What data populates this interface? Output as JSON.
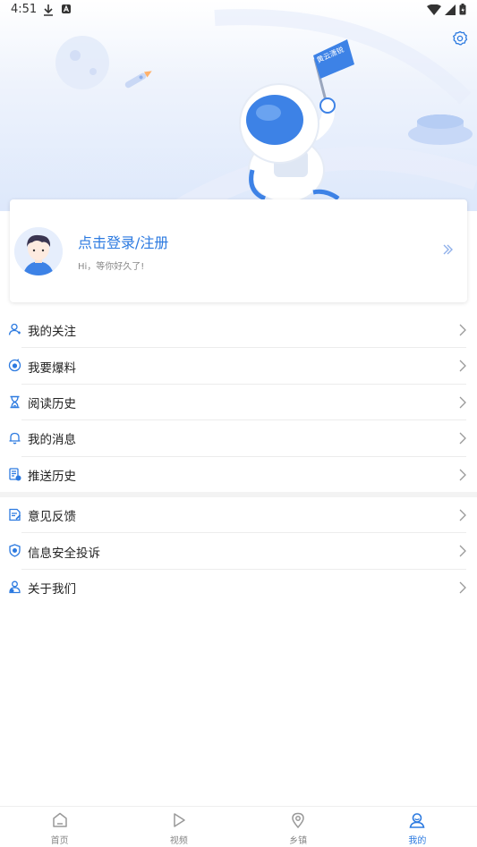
{
  "status": {
    "time": "4:51"
  },
  "hero": {
    "flag_text": "黄云潇锐"
  },
  "login": {
    "title": "点击登录/注册",
    "subtitle": "Hi，等你好久了!"
  },
  "menu_group_1": [
    {
      "label": "我的关注",
      "icon": "user-follow-icon"
    },
    {
      "label": "我要爆料",
      "icon": "report-news-icon"
    },
    {
      "label": "阅读历史",
      "icon": "hourglass-icon"
    },
    {
      "label": "我的消息",
      "icon": "bell-icon"
    },
    {
      "label": "推送历史",
      "icon": "push-history-icon"
    }
  ],
  "menu_group_2": [
    {
      "label": "意见反馈",
      "icon": "feedback-icon"
    },
    {
      "label": "信息安全投诉",
      "icon": "shield-icon"
    },
    {
      "label": "关于我们",
      "icon": "about-us-icon"
    }
  ],
  "tabs": [
    {
      "label": "首页",
      "icon": "home-icon",
      "active": false
    },
    {
      "label": "视频",
      "icon": "play-icon",
      "active": false
    },
    {
      "label": "乡镇",
      "icon": "location-pin-icon",
      "active": false
    },
    {
      "label": "我的",
      "icon": "profile-icon",
      "active": true
    }
  ],
  "colors": {
    "accent": "#2c7ae0",
    "text": "#222222",
    "muted": "#888888",
    "chevron": "#999999"
  }
}
